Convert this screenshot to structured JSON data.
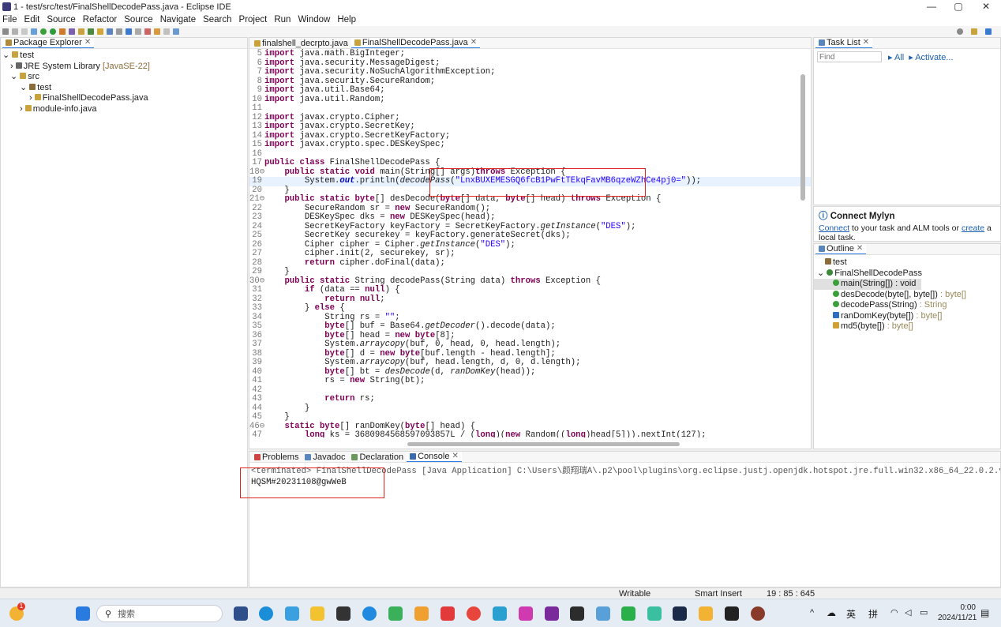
{
  "window": {
    "title": "1 - test/src/test/FinalShellDecodePass.java - Eclipse IDE",
    "min": "—",
    "max": "▢",
    "close": "✕"
  },
  "menu": [
    "File",
    "Edit",
    "Source",
    "Refactor",
    "Source",
    "Navigate",
    "Search",
    "Project",
    "Run",
    "Window",
    "Help"
  ],
  "package_explorer": {
    "tab_label": "Package Explorer",
    "items": [
      {
        "label": "test",
        "arrow": "⌄"
      },
      {
        "label": "JRE System Library",
        "extra": "[JavaSE-22]",
        "arrow": "›"
      },
      {
        "label": "src",
        "arrow": "⌄"
      },
      {
        "label": "test",
        "arrow": "⌄"
      },
      {
        "label": "FinalShellDecodePass.java",
        "arrow": "›"
      },
      {
        "label": "module-info.java",
        "arrow": "›"
      }
    ]
  },
  "editor": {
    "tabs": [
      {
        "label": "finalshell_decrpto.java"
      },
      {
        "label": "FinalShellDecodePass.java"
      }
    ],
    "lines": [
      {
        "n": "5",
        "t": "import java.math.BigInteger;"
      },
      {
        "n": "6",
        "t": "import java.security.MessageDigest;"
      },
      {
        "n": "7",
        "t": "import java.security.NoSuchAlgorithmException;"
      },
      {
        "n": "8",
        "t": "import java.security.SecureRandom;"
      },
      {
        "n": "9",
        "t": "import java.util.Base64;"
      },
      {
        "n": "10",
        "t": "import java.util.Random;"
      },
      {
        "n": "11",
        "t": ""
      },
      {
        "n": "12",
        "t": "import javax.crypto.Cipher;"
      },
      {
        "n": "13",
        "t": "import javax.crypto.SecretKey;"
      },
      {
        "n": "14",
        "t": "import javax.crypto.SecretKeyFactory;"
      },
      {
        "n": "15",
        "t": "import javax.crypto.spec.DESKeySpec;"
      },
      {
        "n": "16",
        "t": ""
      },
      {
        "n": "17",
        "t": "public class FinalShellDecodePass {"
      },
      {
        "n": "18⊖",
        "t": "    public static void main(String[] args)throws Exception {"
      },
      {
        "n": "19",
        "t": "        System.out.println(decodePass(\"LnxBUXEMESGQ6fcB1PwFtTEkqFavMB6qzeWZhCe4pj0=\"));"
      },
      {
        "n": "20",
        "t": "    }"
      },
      {
        "n": "21⊖",
        "t": "    public static byte[] desDecode(byte[] data, byte[] head) throws Exception {"
      },
      {
        "n": "22",
        "t": "        SecureRandom sr = new SecureRandom();"
      },
      {
        "n": "23",
        "t": "        DESKeySpec dks = new DESKeySpec(head);"
      },
      {
        "n": "24",
        "t": "        SecretKeyFactory keyFactory = SecretKeyFactory.getInstance(\"DES\");"
      },
      {
        "n": "25",
        "t": "        SecretKey securekey = keyFactory.generateSecret(dks);"
      },
      {
        "n": "26",
        "t": "        Cipher cipher = Cipher.getInstance(\"DES\");"
      },
      {
        "n": "27",
        "t": "        cipher.init(2, securekey, sr);"
      },
      {
        "n": "28",
        "t": "        return cipher.doFinal(data);"
      },
      {
        "n": "29",
        "t": "    }"
      },
      {
        "n": "30⊖",
        "t": "    public static String decodePass(String data) throws Exception {"
      },
      {
        "n": "31",
        "t": "        if (data == null) {"
      },
      {
        "n": "32",
        "t": "            return null;"
      },
      {
        "n": "33",
        "t": "        } else {"
      },
      {
        "n": "34",
        "t": "            String rs = \"\";"
      },
      {
        "n": "35",
        "t": "            byte[] buf = Base64.getDecoder().decode(data);"
      },
      {
        "n": "36",
        "t": "            byte[] head = new byte[8];"
      },
      {
        "n": "37",
        "t": "            System.arraycopy(buf, 0, head, 0, head.length);"
      },
      {
        "n": "38",
        "t": "            byte[] d = new byte[buf.length - head.length];"
      },
      {
        "n": "39",
        "t": "            System.arraycopy(buf, head.length, d, 0, d.length);"
      },
      {
        "n": "40",
        "t": "            byte[] bt = desDecode(d, ranDomKey(head));"
      },
      {
        "n": "41",
        "t": "            rs = new String(bt);"
      },
      {
        "n": "42",
        "t": ""
      },
      {
        "n": "43",
        "t": "            return rs;"
      },
      {
        "n": "44",
        "t": "        }"
      },
      {
        "n": "45",
        "t": "    }"
      },
      {
        "n": "46⊖",
        "t": "    static byte[] ranDomKey(byte[] head) {"
      },
      {
        "n": "47",
        "t": "        long ks = 3680984568597093857L / (long)(new Random((long)head[5])).nextInt(127);"
      }
    ]
  },
  "task_list": {
    "tab_label": "Task List",
    "find_placeholder": "Find",
    "all": "All",
    "activate": "Activate..."
  },
  "mylyn": {
    "title": "Connect Mylyn",
    "connect": "Connect",
    "mid": " to your task and ALM tools or ",
    "create": "create",
    "tail": " a local task."
  },
  "outline": {
    "tab_label": "Outline",
    "items": [
      {
        "label": "test",
        "type": ""
      },
      {
        "label": "FinalShellDecodePass",
        "type": ""
      },
      {
        "label": "main(String[])",
        "type": " : void"
      },
      {
        "label": "desDecode(byte[], byte[])",
        "type": " : byte[]"
      },
      {
        "label": "decodePass(String)",
        "type": " : String"
      },
      {
        "label": "ranDomKey(byte[])",
        "type": " : byte[]"
      },
      {
        "label": "md5(byte[])",
        "type": " : byte[]"
      }
    ]
  },
  "bottom_tabs": [
    "Problems",
    "Javadoc",
    "Declaration",
    "Console"
  ],
  "console": {
    "header": "<terminated> FinalShellDecodePass [Java Application] C:\\Users\\颜翔瑞A\\.p2\\pool\\plugins\\org.eclipse.justj.openjdk.hotspot.jre.full.win32.x86_64_22.0.2.v20240802-1626\\jre\\bin\\javaw.exe  (2024年11月21日 00:00:09 – 00:00:1",
    "output": "HQSM#20231108@gwWeB"
  },
  "status": {
    "writable": "Writable",
    "insert": "Smart Insert",
    "pos": "19 : 85 : 645"
  },
  "taskbar": {
    "search": "搜索",
    "ime1": "英",
    "ime2": "拼",
    "time": "0:00",
    "date": "2024/11/21",
    "badge": "1"
  },
  "colors": {
    "accent": "#2c7be5",
    "highlight_box": "#e0241b",
    "keyword": "#7f0055",
    "string": "#2a00ff"
  }
}
